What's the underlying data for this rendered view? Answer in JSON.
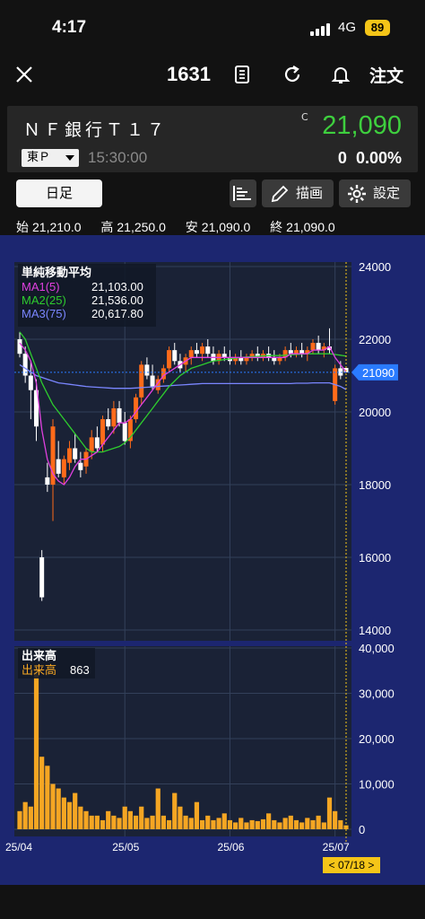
{
  "status": {
    "time": "4:17",
    "network": "4G",
    "battery": "89"
  },
  "header": {
    "code": "1631",
    "order_label": "注文"
  },
  "quote": {
    "name": "ＮＦ銀行Ｔ１７",
    "market": "東Ｐ",
    "time": "15:30:00",
    "price_flag": "C",
    "price": "21,090",
    "change": "0",
    "change_pct": "0.00%"
  },
  "toolbar": {
    "period": "日足",
    "draw_label": "描画",
    "settings_label": "設定"
  },
  "ohlc": {
    "open_label": "始",
    "open": "21,210.0",
    "high_label": "高",
    "high": "21,250.0",
    "low_label": "安",
    "low": "21,090.0",
    "close_label": "終",
    "close": "21,090.0"
  },
  "colors": {
    "up": "#ff6b1a",
    "down": "#ffffff",
    "ma1": "#e040e0",
    "ma2": "#2ecc2e",
    "ma3": "#7a86ff",
    "volume": "#f5a623",
    "price_tag": "#2a7bff",
    "badge": "#f5c518"
  },
  "chart_data": [
    {
      "type": "candlestick",
      "title": "単純移動平均",
      "y_ticks": [
        "24000",
        "22000",
        "20000",
        "18000",
        "16000",
        "14000"
      ],
      "ylim": [
        14000,
        24000
      ],
      "x_ticks": [
        "25/04",
        "25/05",
        "25/06",
        "25/07"
      ],
      "current_price_label": "21090",
      "legend": [
        {
          "name": "MA1(5)",
          "value": "21,103.00"
        },
        {
          "name": "MA2(25)",
          "value": "21,536.00"
        },
        {
          "name": "MA3(75)",
          "value": "20,617.80"
        }
      ],
      "candles": [
        [
          22000,
          22200,
          21500,
          21600
        ],
        [
          21600,
          21800,
          20800,
          21000
        ],
        [
          21000,
          21400,
          19800,
          20600
        ],
        [
          20600,
          20900,
          19200,
          19600
        ],
        [
          16000,
          16200,
          14800,
          14900
        ],
        [
          18200,
          18600,
          17800,
          18000
        ],
        [
          18000,
          19800,
          17000,
          19600
        ],
        [
          18700,
          19200,
          18200,
          18300
        ],
        [
          18200,
          18800,
          18000,
          18700
        ],
        [
          18600,
          19200,
          18400,
          19000
        ],
        [
          19000,
          19400,
          18600,
          18700
        ],
        [
          18600,
          18900,
          18200,
          18400
        ],
        [
          18500,
          19000,
          18300,
          18900
        ],
        [
          18900,
          19500,
          18700,
          19300
        ],
        [
          19300,
          19600,
          18900,
          19000
        ],
        [
          19100,
          19900,
          18900,
          19800
        ],
        [
          19800,
          20100,
          19500,
          19600
        ],
        [
          19600,
          20300,
          19400,
          20100
        ],
        [
          20100,
          20300,
          19600,
          19700
        ],
        [
          19700,
          20000,
          19100,
          19200
        ],
        [
          19200,
          19900,
          19000,
          19800
        ],
        [
          19800,
          20500,
          19700,
          20400
        ],
        [
          20400,
          21400,
          20200,
          21300
        ],
        [
          21300,
          21500,
          20900,
          21000
        ],
        [
          21000,
          21300,
          20600,
          20700
        ],
        [
          20600,
          21000,
          20500,
          20900
        ],
        [
          20900,
          21300,
          20800,
          21200
        ],
        [
          21200,
          21800,
          21100,
          21700
        ],
        [
          21700,
          21900,
          21300,
          21400
        ],
        [
          21400,
          21600,
          21100,
          21200
        ],
        [
          21300,
          21600,
          21100,
          21500
        ],
        [
          21500,
          21800,
          21300,
          21700
        ],
        [
          21700,
          21900,
          21500,
          21600
        ],
        [
          21600,
          21900,
          21400,
          21800
        ],
        [
          21800,
          22000,
          21500,
          21600
        ],
        [
          21600,
          21800,
          21300,
          21400
        ],
        [
          21400,
          21700,
          21300,
          21600
        ],
        [
          21600,
          21800,
          21400,
          21500
        ],
        [
          21500,
          21700,
          21300,
          21400
        ],
        [
          21400,
          21600,
          21300,
          21500
        ],
        [
          21500,
          21700,
          21300,
          21400
        ],
        [
          21400,
          21600,
          21300,
          21500
        ],
        [
          21500,
          21700,
          21400,
          21600
        ],
        [
          21600,
          21800,
          21400,
          21500
        ],
        [
          21500,
          21700,
          21400,
          21600
        ],
        [
          21600,
          21800,
          21400,
          21500
        ],
        [
          21500,
          21700,
          21300,
          21400
        ],
        [
          21400,
          21600,
          21300,
          21500
        ],
        [
          21500,
          21800,
          21400,
          21700
        ],
        [
          21700,
          21900,
          21500,
          21600
        ],
        [
          21600,
          21800,
          21500,
          21700
        ],
        [
          21700,
          21900,
          21500,
          21600
        ],
        [
          21600,
          21800,
          21400,
          21700
        ],
        [
          21700,
          22000,
          21600,
          21900
        ],
        [
          21900,
          22100,
          21600,
          21700
        ],
        [
          21700,
          21900,
          21500,
          21800
        ],
        [
          21800,
          22300,
          21600,
          21700
        ],
        [
          20300,
          21300,
          20200,
          21200
        ],
        [
          21200,
          21400,
          20900,
          21000
        ],
        [
          21210,
          21250,
          21090,
          21090
        ]
      ],
      "ma1": [
        21900,
        21700,
        21400,
        20800,
        19500,
        18700,
        18300,
        18100,
        18000,
        18200,
        18500,
        18700,
        18700,
        18800,
        18900,
        19100,
        19300,
        19500,
        19700,
        19700,
        19800,
        20000,
        20200,
        20400,
        20600,
        20800,
        21000,
        21100,
        21200,
        21300,
        21400,
        21500,
        21500,
        21500,
        21500,
        21500,
        21500,
        21500,
        21500,
        21500,
        21500,
        21500,
        21500,
        21500,
        21500,
        21500,
        21500,
        21500,
        21500,
        21600,
        21600,
        21600,
        21600,
        21700,
        21700,
        21700,
        21800,
        21500,
        21300,
        21103
      ],
      "ma2": [
        22200,
        22000,
        21600,
        21200,
        20800,
        20500,
        20200,
        20000,
        19800,
        19600,
        19400,
        19200,
        19000,
        18900,
        18900,
        18900,
        18950,
        19000,
        19050,
        19150,
        19300,
        19500,
        19700,
        19900,
        20100,
        20300,
        20500,
        20700,
        20850,
        21000,
        21100,
        21200,
        21250,
        21300,
        21350,
        21400,
        21420,
        21440,
        21460,
        21480,
        21500,
        21510,
        21520,
        21530,
        21540,
        21550,
        21550,
        21550,
        21560,
        21570,
        21580,
        21590,
        21600,
        21600,
        21600,
        21600,
        21600,
        21580,
        21560,
        21536
      ],
      "ma3": [
        21300,
        21200,
        21100,
        21000,
        20950,
        20900,
        20850,
        20800,
        20780,
        20760,
        20740,
        20720,
        20700,
        20690,
        20680,
        20670,
        20660,
        20650,
        20650,
        20650,
        20650,
        20660,
        20670,
        20680,
        20690,
        20700,
        20710,
        20720,
        20730,
        20740,
        20750,
        20760,
        20770,
        20780,
        20780,
        20780,
        20780,
        20780,
        20780,
        20780,
        20780,
        20780,
        20780,
        20780,
        20780,
        20780,
        20780,
        20780,
        20780,
        20780,
        20790,
        20790,
        20790,
        20800,
        20800,
        20800,
        20800,
        20750,
        20700,
        20618
      ]
    },
    {
      "type": "bar",
      "title": "出来高",
      "legend": [
        {
          "name": "出来高",
          "value": "863"
        }
      ],
      "y_ticks": [
        "40,000",
        "30,000",
        "20,000",
        "10,000",
        "0"
      ],
      "ylim": [
        0,
        40000
      ],
      "values": [
        4000,
        6000,
        5000,
        36000,
        16000,
        14000,
        10000,
        9000,
        7000,
        6000,
        8000,
        5000,
        4000,
        3000,
        3000,
        2000,
        4000,
        3000,
        2500,
        5000,
        4000,
        3000,
        5000,
        2500,
        3000,
        9000,
        3000,
        2000,
        8000,
        5000,
        3000,
        2500,
        6000,
        2000,
        3000,
        2000,
        2500,
        3500,
        2000,
        1500,
        2500,
        1500,
        2000,
        1800,
        2200,
        3500,
        2000,
        1500,
        2500,
        3000,
        2000,
        1500,
        2500,
        2000,
        3000,
        1500,
        7000,
        4000,
        2000,
        863
      ],
      "x_ticks": [
        "25/04",
        "25/05",
        "25/06",
        "25/07"
      ],
      "cursor_label": "< 07/18 >"
    }
  ]
}
